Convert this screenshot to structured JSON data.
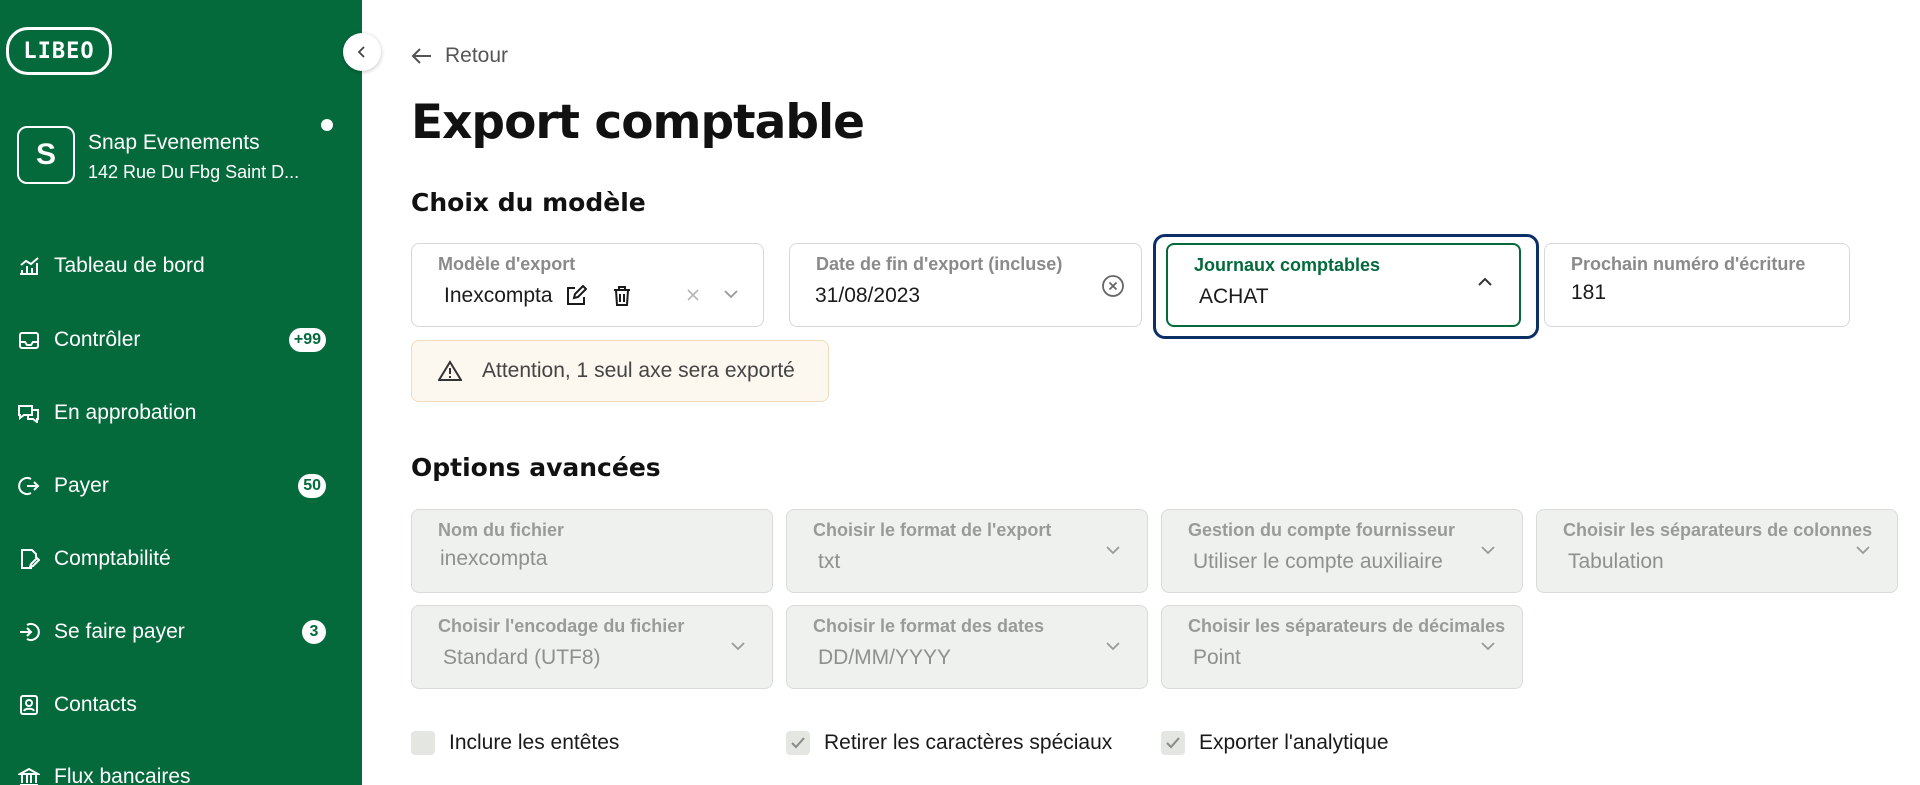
{
  "brand": {
    "logo_text": "LIBEO",
    "accent": "#046a3c",
    "focus_ring": "#0c2f66"
  },
  "company": {
    "initial": "S",
    "name": "Snap Evenements",
    "address": "142 Rue Du Fbg Saint D..."
  },
  "sidebar": {
    "items": [
      {
        "label": "Tableau de bord",
        "icon": "chart-icon",
        "badge": ""
      },
      {
        "label": "Contrôler",
        "icon": "inbox-icon",
        "badge": "+99"
      },
      {
        "label": "En approbation",
        "icon": "chat-icon",
        "badge": ""
      },
      {
        "label": "Payer",
        "icon": "pay-out-icon",
        "badge": "50"
      },
      {
        "label": "Comptabilité",
        "icon": "document-edit-icon",
        "badge": ""
      },
      {
        "label": "Se faire payer",
        "icon": "pay-in-icon",
        "badge": "3"
      },
      {
        "label": "Contacts",
        "icon": "contact-card-icon",
        "badge": ""
      },
      {
        "label": "Flux bancaires",
        "icon": "bank-icon",
        "badge": ""
      }
    ]
  },
  "header": {
    "back_label": "Retour",
    "title": "Export comptable"
  },
  "model_section": {
    "title": "Choix du modèle",
    "export_model": {
      "label": "Modèle d'export",
      "value": "Inexcompta"
    },
    "end_date": {
      "label": "Date de fin d'export (incluse)",
      "value": "31/08/2023"
    },
    "journals": {
      "label": "Journaux comptables",
      "value": "ACHAT"
    },
    "next_entry": {
      "label": "Prochain numéro d'écriture",
      "value": "181"
    },
    "warning": "Attention, 1 seul axe sera exporté"
  },
  "advanced_section": {
    "title": "Options avancées",
    "file_name": {
      "label": "Nom du fichier",
      "value": "inexcompta"
    },
    "export_format": {
      "label": "Choisir le format de l'export",
      "value": "txt"
    },
    "supplier_account": {
      "label": "Gestion du compte fournisseur",
      "value": "Utiliser le compte auxiliaire"
    },
    "column_separator": {
      "label": "Choisir les séparateurs de colonnes",
      "value": "Tabulation"
    },
    "encoding": {
      "label": "Choisir l'encodage du fichier",
      "value": "Standard (UTF8)"
    },
    "date_format": {
      "label": "Choisir le format des dates",
      "value": "DD/MM/YYYY"
    },
    "decimal_separator": {
      "label": "Choisir les séparateurs de décimales",
      "value": "Point"
    }
  },
  "checkboxes": [
    {
      "label": "Inclure les entêtes",
      "checked": false
    },
    {
      "label": "Retirer les caractères spéciaux",
      "checked": true
    },
    {
      "label": "Exporter l'analytique",
      "checked": true
    }
  ]
}
